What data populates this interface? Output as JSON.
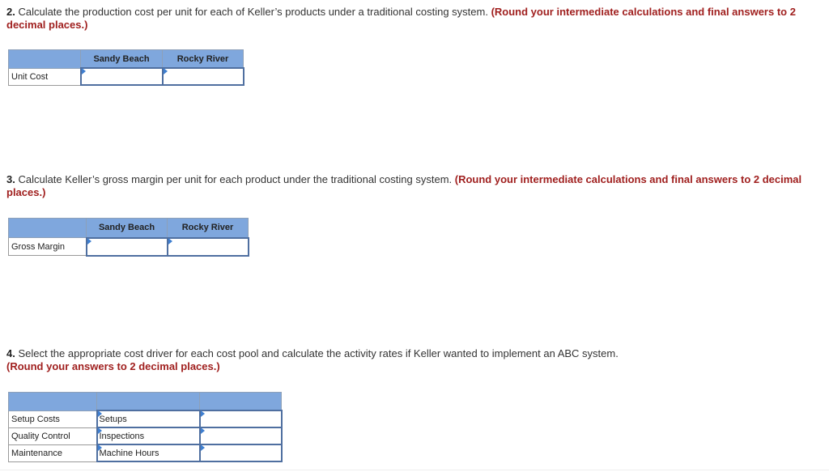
{
  "question2": {
    "number": "2.",
    "text": " Calculate the production cost per unit for each of Keller’s products under a traditional costing system. ",
    "note": "(Round your intermediate calculations and final answers to 2 decimal places.)",
    "table": {
      "headers": [
        "",
        "Sandy Beach",
        "Rocky River"
      ],
      "row_label": "Unit Cost",
      "values": [
        "",
        ""
      ]
    }
  },
  "question3": {
    "number": "3.",
    "text": " Calculate Keller’s gross margin per unit for each product under the traditional costing system. ",
    "note": "(Round your intermediate calculations and final answers to 2 decimal places.)",
    "table": {
      "headers": [
        "",
        "Sandy Beach",
        "Rocky River"
      ],
      "row_label": "Gross Margin",
      "values": [
        "",
        ""
      ]
    }
  },
  "question4": {
    "number": "4.",
    "text": " Select the appropriate cost driver for each cost pool and calculate the activity rates if Keller wanted to implement an ABC system. ",
    "note": "(Round your answers to 2 decimal places.)",
    "table": {
      "headers": [
        "",
        "",
        ""
      ],
      "rows": [
        {
          "label": "Setup Costs",
          "driver": "Setups",
          "rate": ""
        },
        {
          "label": "Quality Control",
          "driver": "Inspections",
          "rate": ""
        },
        {
          "label": "Maintenance",
          "driver": "Machine Hours",
          "rate": ""
        }
      ]
    }
  }
}
